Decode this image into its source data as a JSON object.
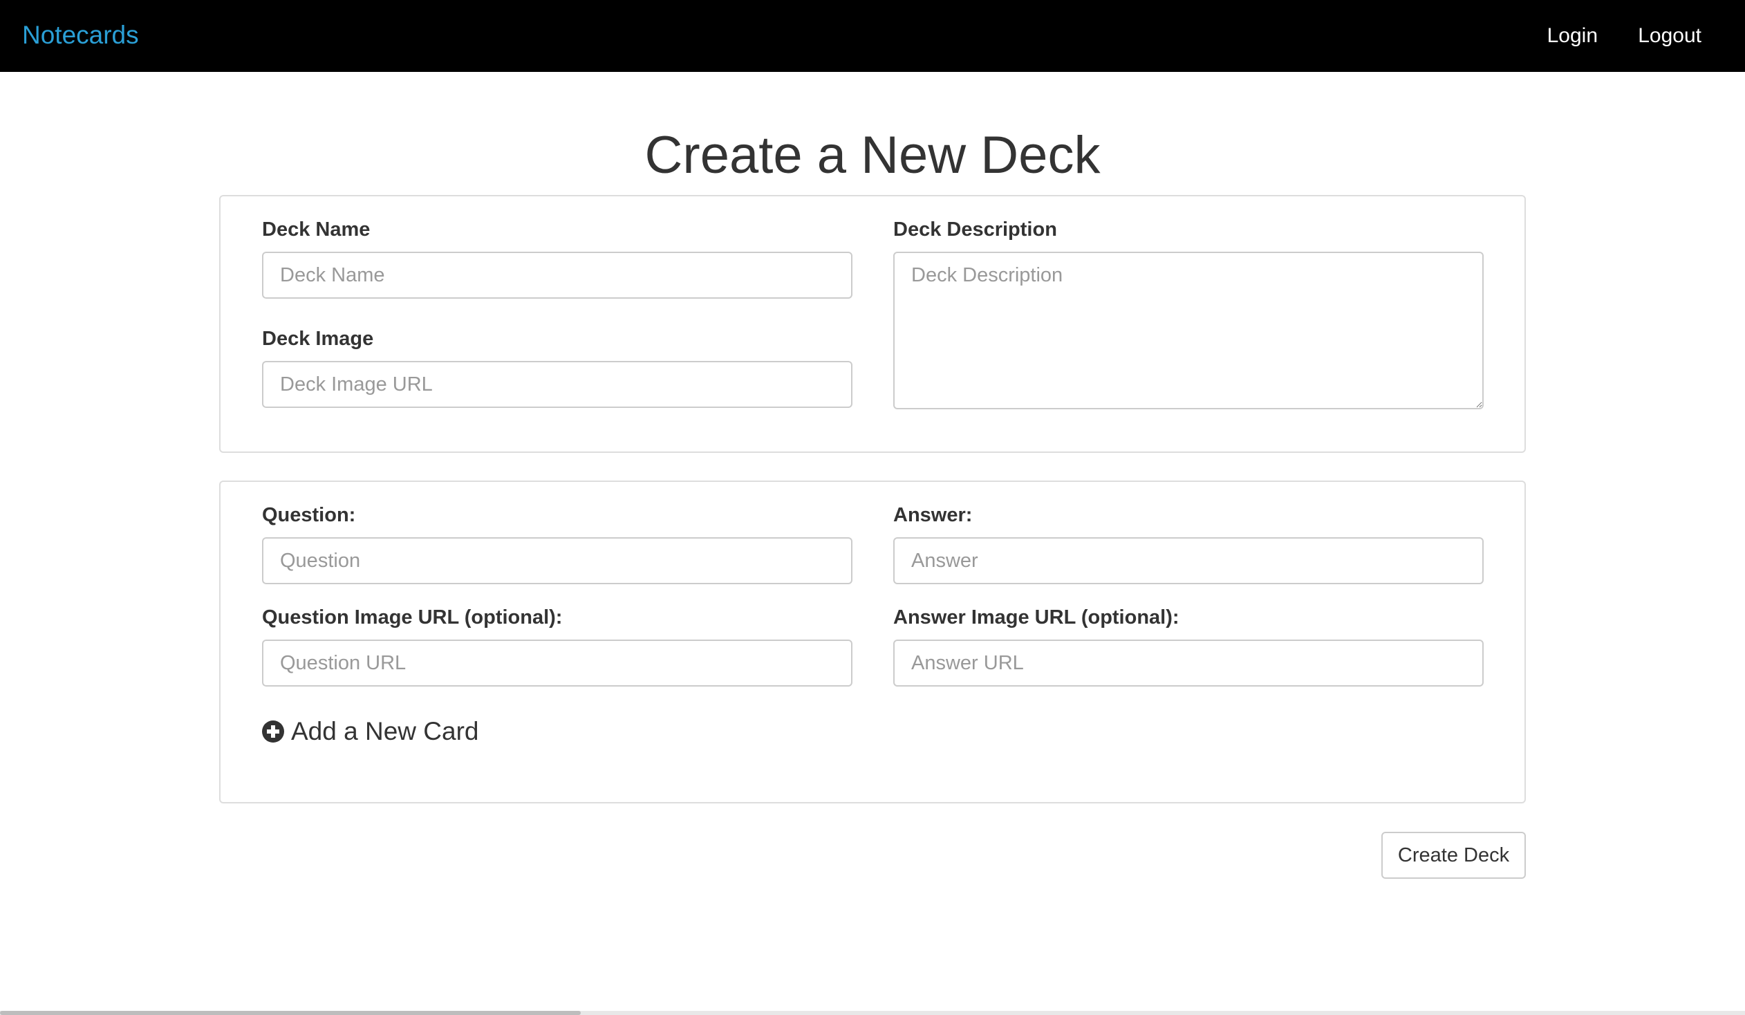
{
  "navbar": {
    "brand": "Notecards",
    "login": "Login",
    "logout": "Logout"
  },
  "page": {
    "title": "Create a New Deck"
  },
  "deck_form": {
    "name_label": "Deck Name",
    "name_placeholder": "Deck Name",
    "name_value": "",
    "image_label": "Deck Image",
    "image_placeholder": "Deck Image URL",
    "image_value": "",
    "description_label": "Deck Description",
    "description_placeholder": "Deck Description",
    "description_value": ""
  },
  "card_form": {
    "question_label": "Question:",
    "question_placeholder": "Question",
    "answer_label": "Answer:",
    "answer_placeholder": "Answer",
    "question_image_label": "Question Image URL (optional):",
    "question_image_placeholder": "Question URL",
    "answer_image_label": "Answer Image URL (optional):",
    "answer_image_placeholder": "Answer URL",
    "add_card_label": "Add a New Card"
  },
  "actions": {
    "create_deck": "Create Deck"
  },
  "colors": {
    "brand": "#2a9fd6",
    "navbar_bg": "#000000",
    "text": "#333333",
    "border": "#cccccc"
  },
  "icons": {
    "add_card": "plus-circle-icon"
  }
}
